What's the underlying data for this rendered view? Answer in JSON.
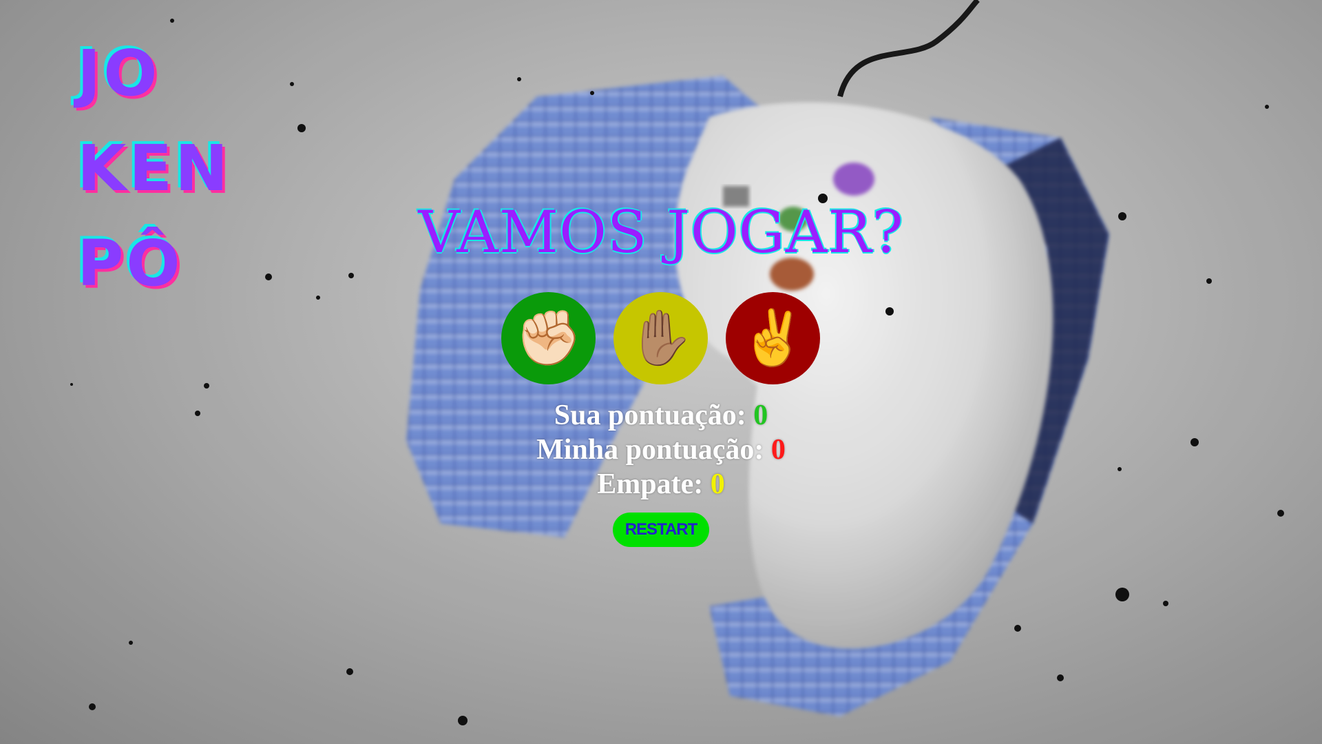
{
  "logo": {
    "lines": [
      "JO",
      "KEN",
      "PÔ"
    ]
  },
  "title": "VAMOS JOGAR?",
  "choices": [
    {
      "name": "pedra",
      "icon": "fist-icon",
      "glyph": "✊🏻",
      "color": "#0a9a0a"
    },
    {
      "name": "papel",
      "icon": "raised-hand-icon",
      "glyph": "✋🏽",
      "color": "#c6c600"
    },
    {
      "name": "tesoura",
      "icon": "victory-hand-icon",
      "glyph": "✌️",
      "color": "#9e0000"
    }
  ],
  "scores": {
    "player_label": "Sua pontuação:",
    "player_value": "0",
    "machine_label": "Minha pontuação:",
    "machine_value": "0",
    "tie_label": "Empate:",
    "tie_value": "0"
  },
  "restart_label": "RESTART",
  "colors": {
    "win": "#22c522",
    "lose": "#ff1a1a",
    "tie": "#f2f200",
    "restart_bg": "#00e000",
    "restart_text": "#2222cc",
    "title": "#9b1dff",
    "title_outline": "#19e6e6"
  }
}
